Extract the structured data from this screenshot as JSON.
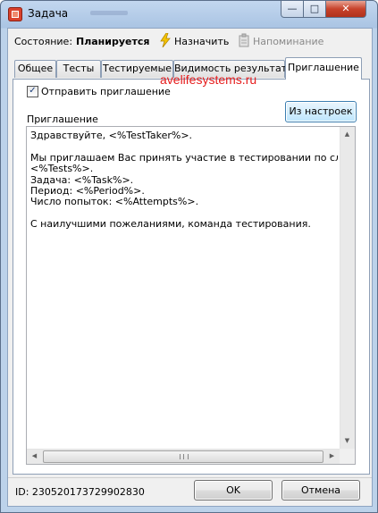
{
  "window": {
    "title": "Задача",
    "controls": {
      "minimize": "—",
      "maximize": "□",
      "close": "✕"
    }
  },
  "status": {
    "label": "Состояние:",
    "value": "Планируется",
    "assign_label": "Назначить",
    "reminder_label": "Напоминание"
  },
  "tabs": [
    {
      "label": "Общее"
    },
    {
      "label": "Тесты"
    },
    {
      "label": "Тестируемые"
    },
    {
      "label": "Видимость результата"
    },
    {
      "label": "Приглашение"
    }
  ],
  "invitation": {
    "send_checkbox_label": "Отправить приглашение",
    "send_checked": true,
    "from_settings_button": "Из настроек",
    "field_label": "Приглашение",
    "text": "Здравствуйте, <%TestTaker%>.\n\nМы приглашаем Вас принять участие в тестировании по следующи\n<%Tests%>.\nЗадача: <%Task%>.\nПериод: <%Period%>.\nЧисло попыток: <%Attempts%>.\n\nС наилучшими пожеланиями, команда тестирования."
  },
  "footer": {
    "id_text": "ID: 230520173729902830",
    "ok_label": "OK",
    "cancel_label": "Отмена"
  },
  "watermark": "avelifesystems.ru",
  "icons": {
    "app": "task-app-icon",
    "assign": "lightning-bolt-icon",
    "reminder": "reminder-clipboard-icon"
  }
}
